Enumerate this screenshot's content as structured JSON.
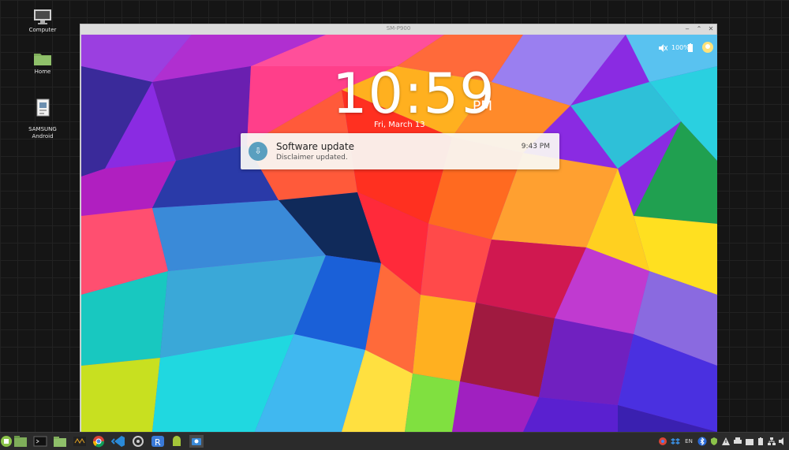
{
  "desktop": {
    "icons": [
      {
        "label": "Computer",
        "icon": "monitor-icon"
      },
      {
        "label": "Home",
        "icon": "folder-icon"
      },
      {
        "label": "SAMSUNG\nAndroid",
        "icon": "document-icon"
      }
    ]
  },
  "window": {
    "title": "SM-P900",
    "buttons": {
      "minimize": "‒",
      "maximize": "⌃",
      "close": "✕"
    }
  },
  "lockscreen": {
    "time": "10:59",
    "ampm": "PM",
    "date": "Fri, March 13",
    "status": {
      "mute_icon": "mute-icon",
      "battery": "100%"
    },
    "notification": {
      "title": "Software update",
      "text": "Disclaimer updated.",
      "time": "9:43 PM",
      "icon": "update-icon"
    }
  },
  "taskbar": {
    "apps": [
      "mint-menu-icon",
      "files-icon",
      "terminal-icon",
      "folder-icon",
      "wireshark-icon",
      "chrome-icon",
      "vscode-icon",
      "settings-icon",
      "r-icon",
      "android-icon",
      "screenshot-icon"
    ],
    "tray": [
      "chrome-icon",
      "dropbox-icon",
      "keyboard-icon",
      "bluetooth-icon",
      "shield-icon",
      "warning-icon",
      "printer-icon",
      "folder-icon",
      "battery-icon",
      "network-icon",
      "volume-icon"
    ],
    "tray_text": {
      "keyboard": "EN"
    }
  },
  "colors": {
    "notification_icon": "#5a9fbf",
    "desktop_bg": "#151515"
  }
}
